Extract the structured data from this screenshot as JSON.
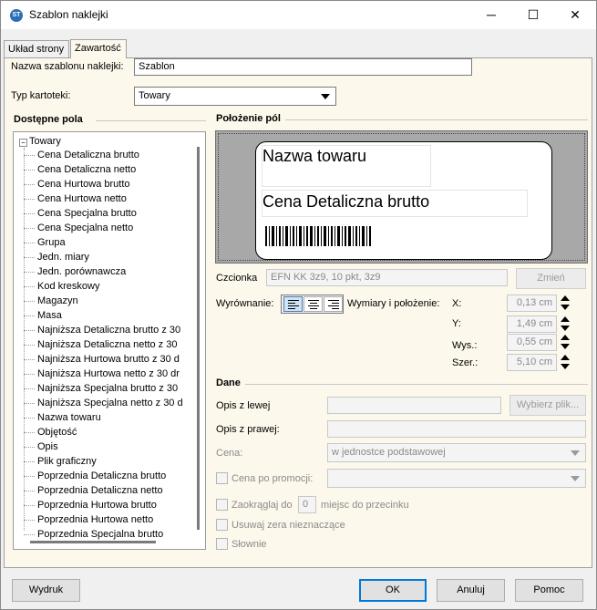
{
  "window": {
    "title": "Szablon naklejki",
    "icon": "app-logo-icon",
    "controls": {
      "minimize": "─",
      "maximize": "☐",
      "close": "✕"
    }
  },
  "tabs": [
    {
      "label": "Układ strony",
      "active": false
    },
    {
      "label": "Zawartość",
      "active": true
    }
  ],
  "form": {
    "template_name_label": "Nazwa szablonu naklejki:",
    "template_name_value": "Szablon",
    "card_type_label": "Typ kartoteki:",
    "card_type_value": "Towary"
  },
  "available_fields": {
    "title": "Dostępne pola",
    "root": "Towary",
    "expander": "−",
    "items": [
      "Cena Detaliczna brutto",
      "Cena Detaliczna netto",
      "Cena Hurtowa brutto",
      "Cena Hurtowa netto",
      "Cena Specjalna brutto",
      "Cena Specjalna netto",
      "Grupa",
      "Jedn. miary",
      "Jedn. porównawcza",
      "Kod kreskowy",
      "Magazyn",
      "Masa",
      "Najniższa Detaliczna brutto z 30",
      "Najniższa Detaliczna netto z 30",
      "Najniższa Hurtowa brutto z 30 d",
      "Najniższa Hurtowa netto z 30 dr",
      "Najniższa Specjalna brutto z 30",
      "Najniższa Specjalna netto z 30 d",
      "Nazwa towaru",
      "Objętość",
      "Opis",
      "Plik graficzny",
      "Poprzednia Detaliczna brutto",
      "Poprzednia Detaliczna netto",
      "Poprzednia Hurtowa brutto",
      "Poprzednia Hurtowa netto",
      "Poprzednia Specjalna brutto"
    ]
  },
  "layout": {
    "title": "Położenie pól",
    "preview": {
      "field1": "Nazwa towaru",
      "field2": "Cena Detaliczna brutto"
    },
    "font_label": "Czcionka",
    "font_value": "EFN KK 3z9, 10 pkt, 3z9",
    "change_button": "Zmień",
    "alignment_label": "Wyrównanie:",
    "dimensions_label": "Wymiary i położenie:",
    "x_label": "X:",
    "x_value": "0,13 cm",
    "y_label": "Y:",
    "y_value": "1,49 cm",
    "h_label": "Wys.:",
    "h_value": "0,55 cm",
    "w_label": "Szer.:",
    "w_value": "5,10 cm"
  },
  "data_section": {
    "title": "Dane",
    "left_desc_label": "Opis z lewej",
    "left_desc_value": "",
    "choose_file_button": "Wybierz plik...",
    "right_desc_label": "Opis z prawej:",
    "right_desc_value": "",
    "price_label": "Cena:",
    "price_value": "w jednostce podstawowej",
    "promo_price_label": "Cena po promocji:",
    "promo_price_value": "",
    "round_label": "Zaokrąglaj do",
    "round_value": "0",
    "round_suffix": "miejsc do przecinku",
    "remove_zeros_label": "Usuwaj zera nieznaczące",
    "in_words_label": "Słownie"
  },
  "footer": {
    "print_button": "Wydruk",
    "ok_button": "OK",
    "cancel_button": "Anuluj",
    "help_button": "Pomoc"
  }
}
